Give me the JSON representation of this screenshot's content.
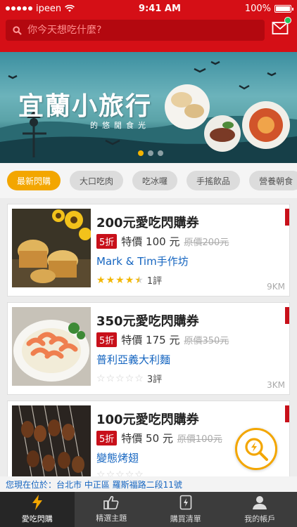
{
  "status_bar": {
    "carrier": "ipeen",
    "time": "9:41 AM",
    "battery": "100%"
  },
  "search": {
    "placeholder": "你今天想吃什麼?"
  },
  "banner": {
    "title": "宜蘭小旅行",
    "subtitle": "的悠閒食光",
    "slide_count": 3,
    "active_slide": 1
  },
  "categories": [
    "最新閃購",
    "大口吃肉",
    "吃冰囉",
    "手搖飲品",
    "營養朝食"
  ],
  "deals": [
    {
      "title": "200元愛吃閃購券",
      "discount": "5折",
      "price_label": "特價 100 元",
      "original_price": "原價200元",
      "shop": "Mark & Tim手作坊",
      "stars": 4.5,
      "reviews": "1評",
      "distance": "9KM"
    },
    {
      "title": "350元愛吃閃購券",
      "discount": "5折",
      "price_label": "特價 175 元",
      "original_price": "原價350元",
      "shop": "普利亞義大利麵",
      "stars": 0,
      "reviews": "3評",
      "distance": "3KM"
    },
    {
      "title": "100元愛吃閃購券",
      "discount": "5折",
      "price_label": "特價 50 元",
      "original_price": "原價100元",
      "shop": "變態烤翅",
      "stars": 0,
      "reviews": "",
      "distance": ""
    }
  ],
  "location": {
    "text": "您現在位於：台北市 中正區 羅斯福路二段11號"
  },
  "tabs": [
    {
      "label": "愛吃閃購",
      "icon": "lightning-icon",
      "active": true
    },
    {
      "label": "精選主題",
      "icon": "thumbs-up-icon",
      "active": false
    },
    {
      "label": "購買清單",
      "icon": "voucher-icon",
      "active": false
    },
    {
      "label": "我的帳戶",
      "icon": "user-icon",
      "active": false
    }
  ],
  "colors": {
    "brand_red": "#d50f16",
    "accent_orange": "#f3a600",
    "link_blue": "#1565c0",
    "tabbar": "#3c3c3c"
  }
}
